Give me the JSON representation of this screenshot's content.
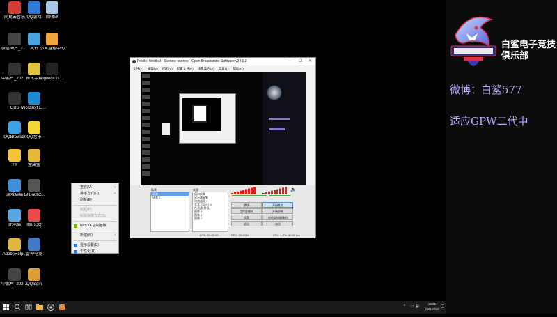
{
  "desktop": {
    "icons": [
      {
        "label": "网易云音乐",
        "color": "#d43c33"
      },
      {
        "label": "QQ游戏",
        "color": "#2f7bd6"
      },
      {
        "label": "回收站",
        "color": "#a8c6e6"
      },
      {
        "label": "微信图片_2020121...",
        "color": "#444444"
      },
      {
        "label": "风铃",
        "color": "#4aa3df"
      },
      {
        "label": "小鱼直播中的",
        "color": "#f2a640"
      },
      {
        "label": "中鹏片_2021023...",
        "color": "#333333"
      },
      {
        "label": "腾讯手游",
        "color": "#e0c340"
      },
      {
        "label": "Logitech G HUB",
        "color": "#222222"
      },
      {
        "label": "OBS",
        "color": "#333333"
      },
      {
        "label": "Microsoft Edge",
        "color": "#1f8ad4"
      },
      {
        "label": "QQBrowser",
        "color": "#3aa0e8"
      },
      {
        "label": "QQ音乐",
        "color": "#f5d535"
      },
      {
        "label": "YY",
        "color": "#f5c23a"
      },
      {
        "label": "金属盟",
        "color": "#e6b83c"
      },
      {
        "label": "游戏猫猫",
        "color": "#3c8fd8"
      },
      {
        "label": "191-a0b2...",
        "color": "#555555"
      },
      {
        "label": "此电脑",
        "color": "#5aa6e0"
      },
      {
        "label": "腾讯QQ",
        "color": "#e84a4a"
      },
      {
        "label": "AdobeHelp...",
        "color": "#e3b642"
      },
      {
        "label": "雷神电竞",
        "color": "#3f7bc8"
      },
      {
        "label": "中鹏片_20210930...",
        "color": "#444444"
      },
      {
        "label": "QQlogin",
        "color": "#d9a03a"
      }
    ]
  },
  "context_menu": {
    "items": [
      {
        "label": "查看(V)",
        "arrow": "›",
        "disabled": false
      },
      {
        "label": "排序方式(O)",
        "arrow": "›",
        "disabled": false
      },
      {
        "label": "刷新(E)",
        "arrow": "",
        "disabled": false
      },
      {
        "label": "粘贴(P)",
        "arrow": "",
        "disabled": true
      },
      {
        "label": "粘贴快捷方式(S)",
        "arrow": "",
        "disabled": true
      },
      {
        "label": "NVIDIA 控制面板",
        "arrow": "",
        "disabled": false
      },
      {
        "label": "新建(W)",
        "arrow": "›",
        "disabled": false
      },
      {
        "label": "显示设置(D)",
        "arrow": "",
        "disabled": false
      },
      {
        "label": "个性化(R)",
        "arrow": "",
        "disabled": false
      }
    ]
  },
  "obs": {
    "title": "Profile: Untitled - Scenes: scenes - Open Broadcaster Software v24.0.3",
    "menu": [
      "文件(F)",
      "编辑(E)",
      "视图(V)",
      "配置文件(P)",
      "场景集合(S)",
      "工具(T)",
      "帮助(H)"
    ],
    "scenes_header": "场景",
    "scenes": [
      "场景",
      "场景 2"
    ],
    "sources_header": "来源",
    "sources": [
      "窗口采集",
      "显示器采集",
      "浏览器源 1",
      "文本 (GDI+) 3",
      "色源(背景框)",
      "图像 5",
      "图像 3",
      "图像 2"
    ],
    "controls": [
      {
        "label": "开始推流",
        "highlight": true
      },
      {
        "label": "开始录制",
        "highlight": false
      },
      {
        "label": "工作室模式",
        "highlight": false
      },
      {
        "label": "设置",
        "highlight": false
      },
      {
        "label": "退出",
        "highlight": false
      },
      {
        "label": "启动虚拟摄像机",
        "highlight": false
      },
      {
        "label": "转场",
        "highlight": false
      },
      {
        "label": "淡出",
        "highlight": false
      }
    ],
    "status": {
      "live": "LIVE: 00:00:00",
      "rec": "REC: 00:00:00",
      "cpu": "CPU: 1.2%, 60.00 fps"
    }
  },
  "side_panel": {
    "club_name": "白鲨电子竞技俱乐部",
    "weibo": "微博：白鲨577",
    "status": "适应GPW二代中"
  },
  "taskbar": {
    "time": "13:21",
    "date": "2021/6/22"
  }
}
